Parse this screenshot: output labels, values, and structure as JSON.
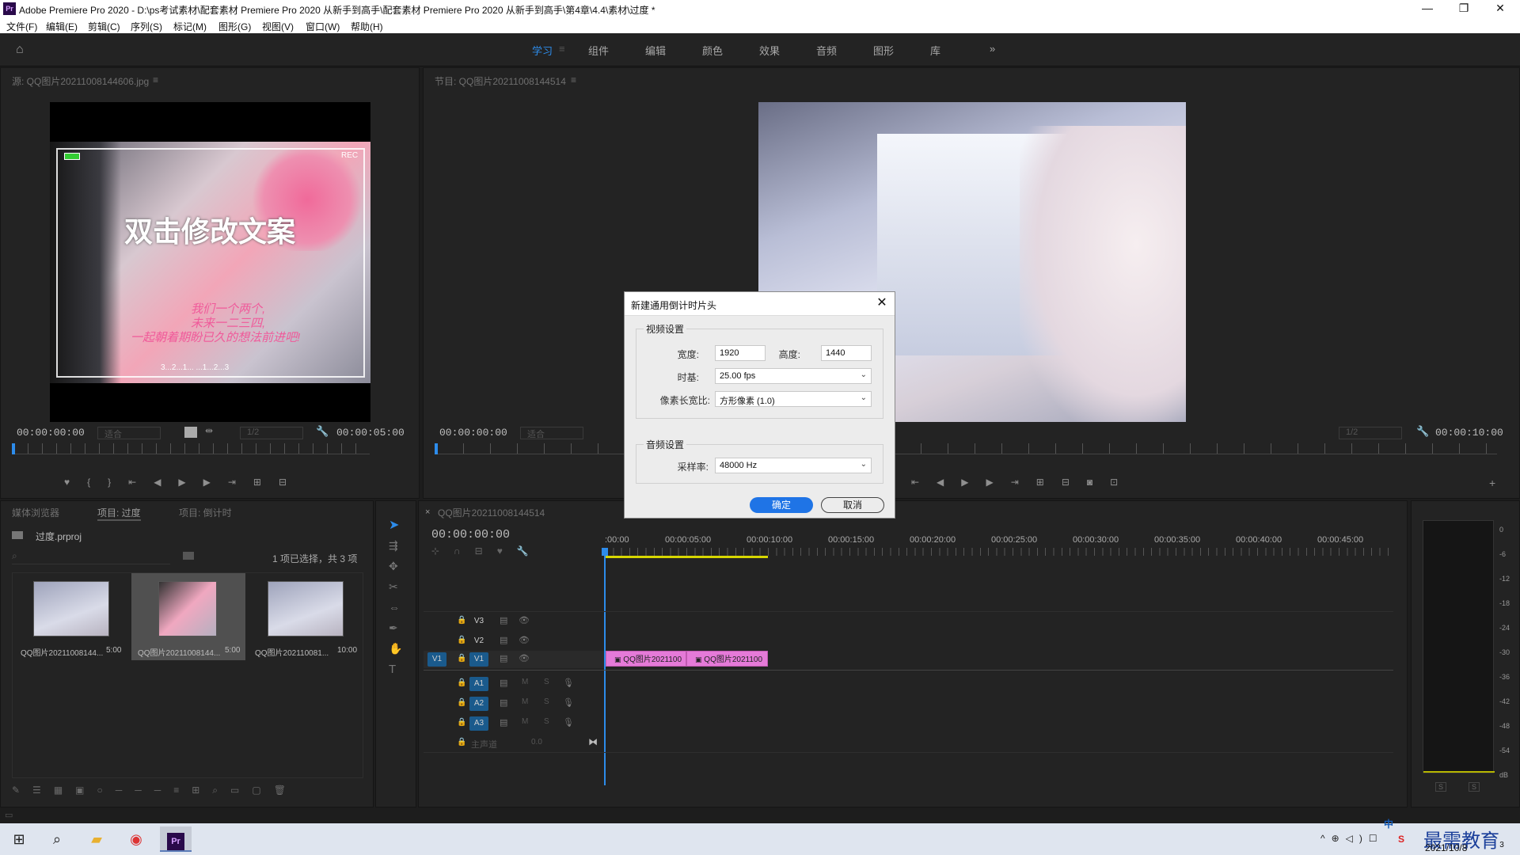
{
  "app": {
    "title": "Adobe Premiere Pro 2020 - D:\\ps考试素材\\配套素材 Premiere Pro 2020 从新手到高手\\配套素材 Premiere Pro 2020 从新手到高手\\第4章\\4.4\\素材\\过度 *",
    "logo": "Pr"
  },
  "window_controls": {
    "minimize": "—",
    "restore": "❐",
    "close": "✕"
  },
  "menu": [
    "文件(F)",
    "编辑(E)",
    "剪辑(C)",
    "序列(S)",
    "标记(M)",
    "图形(G)",
    "视图(V)",
    "窗口(W)",
    "帮助(H)"
  ],
  "workspaces": [
    {
      "label": "学习",
      "active": true
    },
    {
      "label": "组件",
      "active": false
    },
    {
      "label": "编辑",
      "active": false
    },
    {
      "label": "颜色",
      "active": false
    },
    {
      "label": "效果",
      "active": false
    },
    {
      "label": "音频",
      "active": false
    },
    {
      "label": "图形",
      "active": false
    },
    {
      "label": "库",
      "active": false
    }
  ],
  "workspace_more": "»",
  "source_monitor": {
    "title": "源: QQ图片20211008144606.jpg",
    "timecode_in": "00:00:00:00",
    "fit": "适合",
    "resolution": "1/2",
    "timecode_out": "00:00:05:00",
    "overlay_text": "双击修改文案",
    "overlay_sub1": "我们一个两个,",
    "overlay_sub2": "未来一二三四,",
    "overlay_sub3": "一起朝着期盼已久的想法前进吧!",
    "overlay_countdown": "3...2...1...  ...1...2...3",
    "rec_label": "REC"
  },
  "program_monitor": {
    "title": "节目: QQ图片20211008144514",
    "timecode_in": "00:00:00:00",
    "fit": "适合",
    "resolution": "1/2",
    "timecode_out": "00:00:10:00"
  },
  "project_panel": {
    "tabs": [
      "媒体浏览器",
      "项目: 过度",
      "项目: 倒计时"
    ],
    "project_file": "过度.prproj",
    "selection_info": "1 项已选择，共 3 项",
    "items": [
      {
        "name": "QQ图片20211008144...",
        "duration": "5:00"
      },
      {
        "name": "QQ图片20211008144...",
        "duration": "5:00"
      },
      {
        "name": "QQ图片202110081...",
        "duration": "10:00"
      }
    ]
  },
  "timeline": {
    "tab": "QQ图片20211008144514",
    "timecode": "00:00:00:00",
    "ruler": [
      ":00:00",
      "00:00:05:00",
      "00:00:10:00",
      "00:00:15:00",
      "00:00:20:00",
      "00:00:25:00",
      "00:00:30:00",
      "00:00:35:00",
      "00:00:40:00",
      "00:00:45:00"
    ],
    "video_tracks": [
      "V3",
      "V2",
      "V1"
    ],
    "source_patch": "V1",
    "audio_tracks": [
      "A1",
      "A2",
      "A3"
    ],
    "master_label": "主声道",
    "master_value": "0.0",
    "clips": [
      "QQ图片2021100",
      "QQ图片2021100"
    ],
    "ms_labels": {
      "m": "M",
      "s": "S"
    }
  },
  "audio_meter": {
    "scale": [
      "0",
      "-6",
      "-12",
      "-18",
      "-24",
      "-30",
      "-36",
      "-42",
      "-48",
      "-54",
      "dB"
    ],
    "solo": [
      "S",
      "S"
    ]
  },
  "dialog": {
    "title": "新建通用倒计时片头",
    "video_section": "视频设置",
    "width_label": "宽度:",
    "width_value": "1920",
    "height_label": "高度:",
    "height_value": "1440",
    "timebase_label": "时基:",
    "timebase_value": "25.00 fps",
    "par_label": "像素长宽比:",
    "par_value": "方形像素 (1.0)",
    "audio_section": "音频设置",
    "samplerate_label": "采样率:",
    "samplerate_value": "48000 Hz",
    "ok": "确定",
    "cancel": "取消"
  },
  "taskbar": {
    "ime": "中",
    "date": "2021/10/8",
    "watermark": "最需教育",
    "notif_count": "3"
  },
  "colors": {
    "accent": "#2d8ceb",
    "clip": "#e57ad8",
    "track_target": "#1a5a8c",
    "dialog_ok": "#1f74e6"
  }
}
